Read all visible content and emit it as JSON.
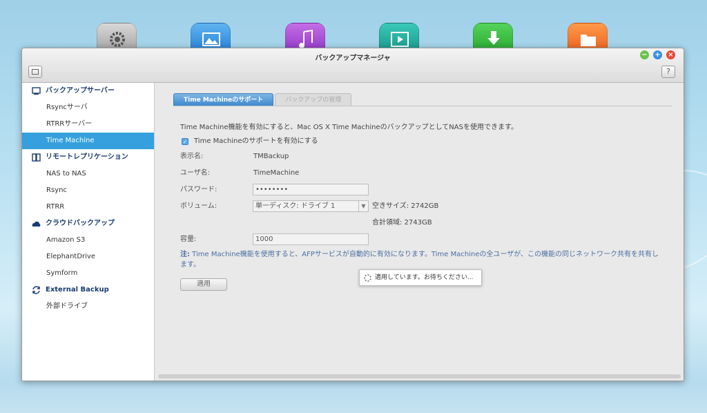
{
  "dock": {
    "icons": [
      "settings-icon",
      "photo-station-icon",
      "music-station-icon",
      "video-station-icon",
      "download-station-icon",
      "file-station-icon"
    ]
  },
  "window": {
    "title": "バックアップマネージャ",
    "help_label": "?"
  },
  "sidebar": {
    "sections": [
      {
        "label": "バックアップサーバー",
        "items": [
          "Rsyncサーバ",
          "RTRRサーバー",
          "Time Machine"
        ]
      },
      {
        "label": "リモートレプリケーション",
        "items": [
          "NAS to NAS",
          "Rsync",
          "RTRR"
        ]
      },
      {
        "label": "クラウドバックアップ",
        "items": [
          "Amazon S3",
          "ElephantDrive",
          "Symform"
        ]
      },
      {
        "label": "External Backup",
        "items": [
          "外部ドライブ"
        ]
      }
    ],
    "active_item": "Time Machine"
  },
  "tabs": [
    "Time Machineのサポート",
    "バックアップの管理"
  ],
  "form": {
    "description": "Time Machine機能を有効にすると、Mac OS X Time MachineのバックアップとしてNASを使用できます。",
    "enable_label": "Time Machineのサポートを有効にする",
    "enable_checked": true,
    "display_name_label": "表示名:",
    "display_name_value": "TMBackup",
    "username_label": "ユーザ名:",
    "username_value": "TimeMachine",
    "password_label": "パスワード:",
    "password_value": "••••••••",
    "volume_label": "ボリューム:",
    "volume_value": "単一ディスク: ドライブ 1",
    "free_space": "空きサイズ: 2742GB",
    "total_area": "合計領域: 2743GB",
    "capacity_label": "容量:",
    "capacity_value": "1000",
    "note_prefix": "注:",
    "note_text": " Time Machine機能を使用すると、AFPサービスが自動的に有効になります。Time Machineの全ユーザが、この機能の同じネットワーク共有を共有します。",
    "apply_label": "適用"
  },
  "loading_text": "適用しています。お待ちください..."
}
